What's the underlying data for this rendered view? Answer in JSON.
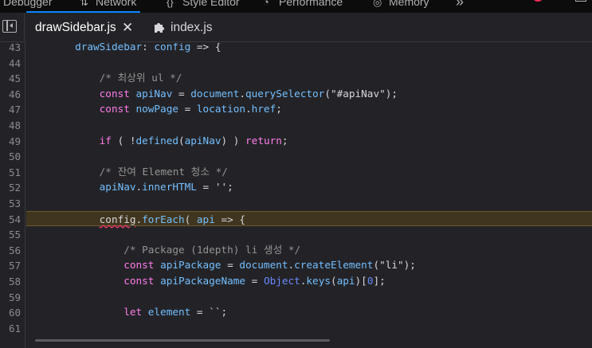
{
  "devtools_tabs": [
    {
      "label": "Debugger",
      "icon": "none"
    },
    {
      "label": "Network",
      "icon": "network-icon"
    },
    {
      "label": "Style Editor",
      "icon": "style-editor-icon"
    },
    {
      "label": "Performance",
      "icon": "performance-icon"
    },
    {
      "label": "Memory",
      "icon": "memory-icon"
    }
  ],
  "devtools_overflow": "»",
  "file_tabs": {
    "active": {
      "label": "drawSidebar.js",
      "close": "✕"
    },
    "other": {
      "label": "index.js"
    }
  },
  "colors": {
    "accent": "#0a84ff",
    "keyword": "#ff7de9",
    "function": "#75bfff",
    "comment": "#939395",
    "highlight_line_bg": "#40361f"
  },
  "editor": {
    "highlighted_line": "54",
    "lines": [
      {
        "n": "43",
        "segments": [
          [
            "fn",
            "        drawSidebar"
          ],
          [
            "op",
            ": "
          ],
          [
            "pr",
            "config"
          ],
          [
            "op",
            " => {"
          ]
        ]
      },
      {
        "n": "44",
        "segments": []
      },
      {
        "n": "45",
        "segments": [
          [
            "cm",
            "            /* 최상위 ul */"
          ]
        ]
      },
      {
        "n": "46",
        "segments": [
          [
            "kw",
            "            const "
          ],
          [
            "pr",
            "apiNav"
          ],
          [
            "op",
            " = "
          ],
          [
            "pr",
            "document"
          ],
          [
            "op",
            "."
          ],
          [
            "fn",
            "querySelector"
          ],
          [
            "op",
            "("
          ],
          [
            "str",
            "\"#apiNav\""
          ],
          [
            "op",
            ");"
          ]
        ]
      },
      {
        "n": "47",
        "segments": [
          [
            "kw",
            "            const "
          ],
          [
            "pr",
            "nowPage"
          ],
          [
            "op",
            " = "
          ],
          [
            "pr",
            "location"
          ],
          [
            "op",
            "."
          ],
          [
            "pr",
            "href"
          ],
          [
            "op",
            ";"
          ]
        ]
      },
      {
        "n": "48",
        "segments": []
      },
      {
        "n": "49",
        "segments": [
          [
            "kw",
            "            if"
          ],
          [
            "op",
            " ( !"
          ],
          [
            "fn",
            "defined"
          ],
          [
            "op",
            "("
          ],
          [
            "pr",
            "apiNav"
          ],
          [
            "op",
            ") ) "
          ],
          [
            "kw",
            "return"
          ],
          [
            "op",
            ";"
          ]
        ]
      },
      {
        "n": "50",
        "segments": []
      },
      {
        "n": "51",
        "segments": [
          [
            "cm",
            "            /* 잔여 Element 청소 */"
          ]
        ]
      },
      {
        "n": "52",
        "segments": [
          [
            "pr",
            "            apiNav"
          ],
          [
            "op",
            "."
          ],
          [
            "pr",
            "innerHTML"
          ],
          [
            "op",
            " = "
          ],
          [
            "str",
            "''"
          ],
          [
            "op",
            ";"
          ]
        ]
      },
      {
        "n": "53",
        "segments": []
      },
      {
        "n": "54",
        "segments": [
          [
            "op",
            "            "
          ],
          [
            "wavy",
            "config"
          ],
          [
            "op",
            "."
          ],
          [
            "fn",
            "forEach"
          ],
          [
            "op",
            "( "
          ],
          [
            "pr",
            "api"
          ],
          [
            "op",
            " => {"
          ]
        ]
      },
      {
        "n": "55",
        "segments": []
      },
      {
        "n": "56",
        "segments": [
          [
            "cm",
            "                /* Package (1depth) li 생성 */"
          ]
        ]
      },
      {
        "n": "57",
        "segments": [
          [
            "kw",
            "                const "
          ],
          [
            "pr",
            "apiPackage"
          ],
          [
            "op",
            " = "
          ],
          [
            "pr",
            "document"
          ],
          [
            "op",
            "."
          ],
          [
            "fn",
            "createElement"
          ],
          [
            "op",
            "("
          ],
          [
            "str",
            "\"li\""
          ],
          [
            "op",
            ");"
          ]
        ]
      },
      {
        "n": "58",
        "segments": [
          [
            "kw",
            "                const "
          ],
          [
            "pr",
            "apiPackageName"
          ],
          [
            "op",
            " = "
          ],
          [
            "obj",
            "Object"
          ],
          [
            "op",
            "."
          ],
          [
            "fn",
            "keys"
          ],
          [
            "op",
            "("
          ],
          [
            "pr",
            "api"
          ],
          [
            "op",
            ")["
          ],
          [
            "num",
            "0"
          ],
          [
            "op",
            "];"
          ]
        ]
      },
      {
        "n": "59",
        "segments": []
      },
      {
        "n": "60",
        "segments": [
          [
            "kw",
            "                let "
          ],
          [
            "pr",
            "element"
          ],
          [
            "op",
            " = "
          ],
          [
            "str",
            "``"
          ],
          [
            "op",
            ";"
          ]
        ]
      },
      {
        "n": "61",
        "segments": []
      }
    ]
  }
}
